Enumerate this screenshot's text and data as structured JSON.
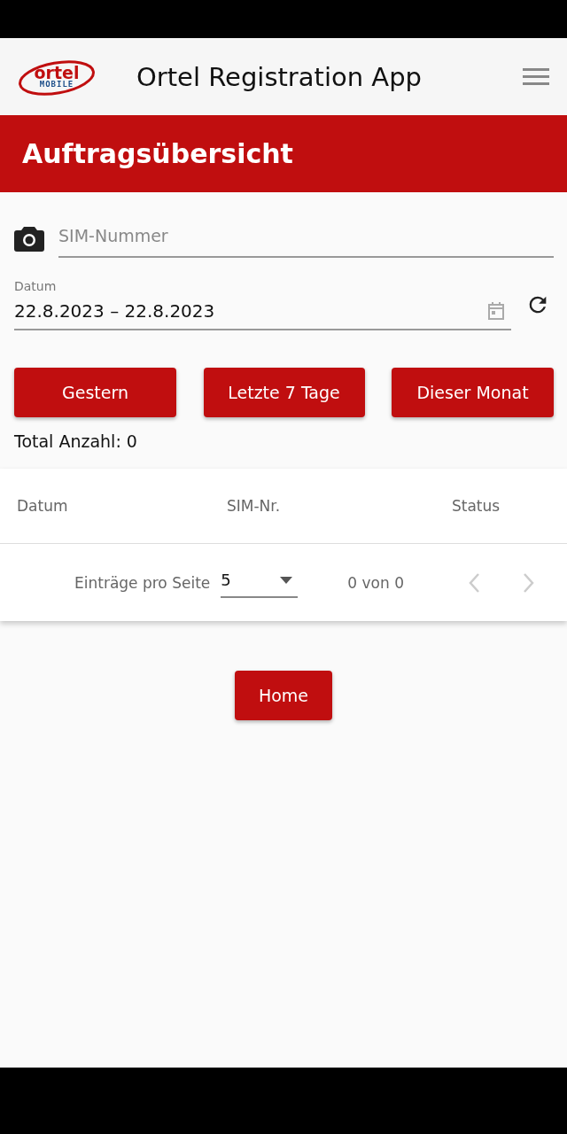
{
  "header": {
    "logo": {
      "word": "ortel",
      "sub": "MOBILE"
    },
    "title": "Ortel Registration App"
  },
  "banner": {
    "title": "Auftragsübersicht"
  },
  "sim_field": {
    "placeholder": "SIM-Nummer"
  },
  "date_field": {
    "label": "Datum",
    "value": "22.8.2023 – 22.8.2023"
  },
  "quick_buttons": [
    "Gestern",
    "Letzte 7 Tage",
    "Dieser Monat"
  ],
  "total": "Total Anzahl: 0",
  "table": {
    "columns": [
      "Datum",
      "SIM-Nr.",
      "Status"
    ]
  },
  "pagination": {
    "label": "Einträge pro Seite",
    "per_page": "5",
    "range": "0 von 0",
    "prev_disabled": true,
    "next_disabled": true
  },
  "home_button": "Home"
}
